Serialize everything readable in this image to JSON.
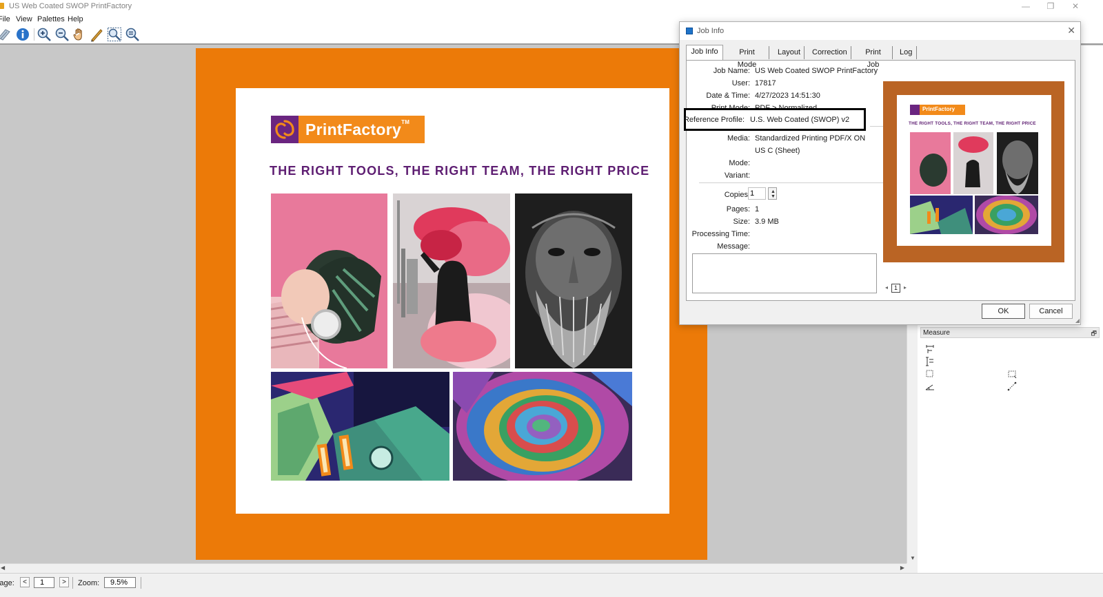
{
  "window": {
    "title": "US Web Coated SWOP PrintFactory",
    "minimize_glyph": "—",
    "restore_glyph": "❐",
    "close_glyph": "✕"
  },
  "menu": [
    {
      "label": "File"
    },
    {
      "label": "View"
    },
    {
      "label": "Palettes"
    },
    {
      "label": "Help"
    }
  ],
  "toolbar": {
    "icons": [
      "pages-icon",
      "info-icon",
      "zoom-in-icon",
      "zoom-out-icon",
      "hand-pan-icon",
      "pencil-icon",
      "zoom-fit-icon",
      "zoom-actual-icon"
    ]
  },
  "document": {
    "logo_text": "PrintFactory",
    "logo_tm": "TM",
    "tagline": "THE RIGHT TOOLS, THE RIGHT TEAM, THE RIGHT PRICE"
  },
  "statusbar": {
    "page_label": "Page:",
    "prev_glyph": "<",
    "page_value": "1",
    "next_glyph": ">",
    "zoom_label": "Zoom:",
    "zoom_value": "9.5%"
  },
  "measure_palette": {
    "title": "Measure",
    "pin_glyph": "🗗"
  },
  "dialog": {
    "title": "Job Info",
    "close_glyph": "✕",
    "tabs": [
      {
        "label": "Job Info",
        "active": true
      },
      {
        "label": "Print Mode",
        "active": false
      },
      {
        "label": "Layout",
        "active": false
      },
      {
        "label": "Correction",
        "active": false
      },
      {
        "label": "Print Job",
        "active": false
      },
      {
        "label": "Log",
        "active": false
      }
    ],
    "fields": {
      "job_name_label": "Job Name:",
      "job_name": "US Web Coated SWOP PrintFactory",
      "user_label": "User:",
      "user": "17817",
      "datetime_label": "Date & Time:",
      "datetime": "4/27/2023 14:51:30",
      "print_mode_label": "Print Mode:",
      "print_mode": "PDF > Normalized",
      "reference_profile_label": "Reference Profile:",
      "reference_profile": "U.S. Web Coated (SWOP) v2",
      "media_label": "Media:",
      "media_line1": "Standardized Printing PDF/X ON",
      "media_line2": "US C (Sheet)",
      "mode_label": "Mode:",
      "variant_label": "Variant:",
      "copies_label": "Copies:",
      "copies": "1",
      "pages_label": "Pages:",
      "pages": "1",
      "size_label": "Size:",
      "size": "3.9 MB",
      "processing_time_label": "Processing Time:",
      "message_label": "Message:"
    },
    "preview": {
      "logo_text": "PrintFactory",
      "tagline": "THE RIGHT TOOLS, THE RIGHT TEAM, THE RIGHT PRICE",
      "page_number": "1",
      "prev_glyph": "◂",
      "next_glyph": "▸"
    },
    "ok_label": "OK",
    "cancel_label": "Cancel"
  },
  "colors": {
    "page_orange": "#ec7a08",
    "brand_purple": "#5e1e72",
    "logo_orange": "#f28a1a",
    "preview_frame": "#ba6424"
  }
}
